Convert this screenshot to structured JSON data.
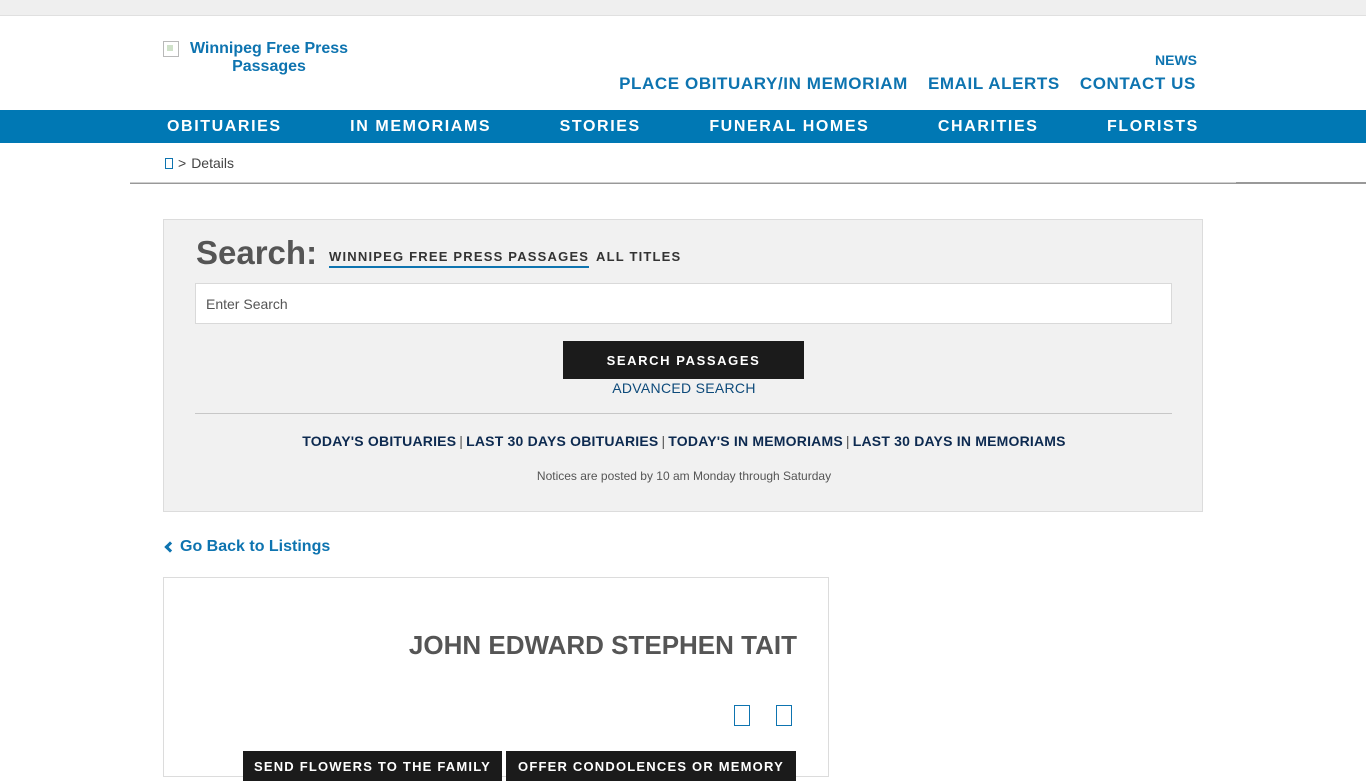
{
  "header": {
    "logo_alt": "Winnipeg Free Press Passages",
    "news_label": "NEWS",
    "links": [
      "PLACE OBITUARY/IN MEMORIAM",
      "EMAIL ALERTS",
      "CONTACT US"
    ]
  },
  "main_nav": {
    "items": [
      "OBITUARIES",
      "IN MEMORIAMS",
      "STORIES",
      "FUNERAL HOMES",
      "CHARITIES",
      "FLORISTS"
    ]
  },
  "breadcrumb": {
    "separator": ">",
    "current": "Details"
  },
  "search": {
    "title": "Search:",
    "tabs": [
      "WINNIPEG FREE PRESS PASSAGES",
      "ALL TITLES"
    ],
    "placeholder": "Enter Search",
    "button_label": "SEARCH PASSAGES",
    "advanced_label": "ADVANCED SEARCH",
    "quick_links": [
      "TODAY'S OBITUARIES",
      "LAST 30 DAYS OBITUARIES",
      "TODAY'S IN MEMORIAMS",
      "LAST 30 DAYS IN MEMORIAMS"
    ],
    "quick_sep": "|",
    "notice": "Notices are posted by 10 am Monday through Saturday"
  },
  "go_back": {
    "label": "Go Back to Listings"
  },
  "obituary": {
    "name": "JOHN EDWARD STEPHEN TAIT",
    "buttons": [
      "SEND FLOWERS TO THE FAMILY",
      "OFFER CONDOLENCES OR MEMORY"
    ]
  },
  "colors": {
    "brand_blue": "#0078b4",
    "link_blue": "#0e74b0",
    "dark_button": "#1b1b1b"
  },
  "icons": {
    "home": "home-icon",
    "back": "chevron-left-icon",
    "share_1": "share-icon",
    "share_2": "share-icon"
  }
}
